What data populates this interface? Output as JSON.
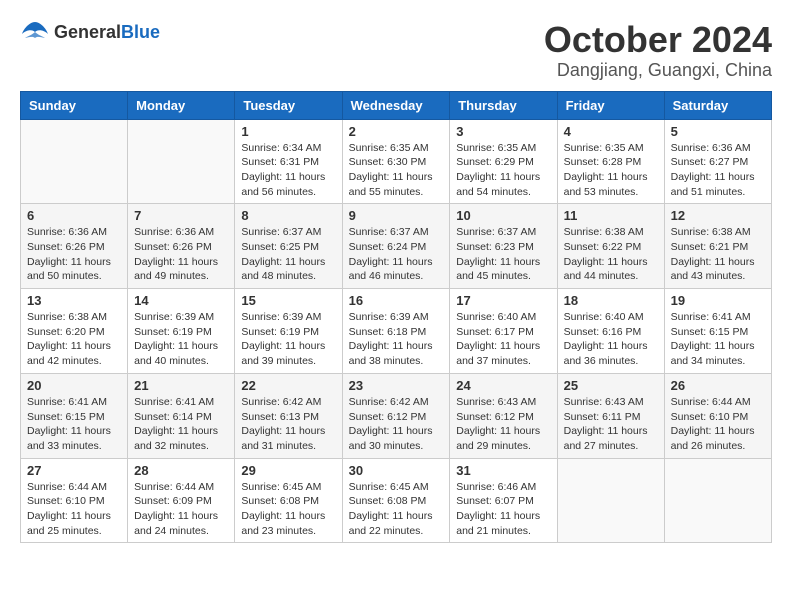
{
  "logo": {
    "general": "General",
    "blue": "Blue"
  },
  "title": "October 2024",
  "location": "Dangjiang, Guangxi, China",
  "days_of_week": [
    "Sunday",
    "Monday",
    "Tuesday",
    "Wednesday",
    "Thursday",
    "Friday",
    "Saturday"
  ],
  "weeks": [
    [
      {
        "day": "",
        "info": ""
      },
      {
        "day": "",
        "info": ""
      },
      {
        "day": "1",
        "sunrise": "Sunrise: 6:34 AM",
        "sunset": "Sunset: 6:31 PM",
        "daylight": "Daylight: 11 hours and 56 minutes."
      },
      {
        "day": "2",
        "sunrise": "Sunrise: 6:35 AM",
        "sunset": "Sunset: 6:30 PM",
        "daylight": "Daylight: 11 hours and 55 minutes."
      },
      {
        "day": "3",
        "sunrise": "Sunrise: 6:35 AM",
        "sunset": "Sunset: 6:29 PM",
        "daylight": "Daylight: 11 hours and 54 minutes."
      },
      {
        "day": "4",
        "sunrise": "Sunrise: 6:35 AM",
        "sunset": "Sunset: 6:28 PM",
        "daylight": "Daylight: 11 hours and 53 minutes."
      },
      {
        "day": "5",
        "sunrise": "Sunrise: 6:36 AM",
        "sunset": "Sunset: 6:27 PM",
        "daylight": "Daylight: 11 hours and 51 minutes."
      }
    ],
    [
      {
        "day": "6",
        "sunrise": "Sunrise: 6:36 AM",
        "sunset": "Sunset: 6:26 PM",
        "daylight": "Daylight: 11 hours and 50 minutes."
      },
      {
        "day": "7",
        "sunrise": "Sunrise: 6:36 AM",
        "sunset": "Sunset: 6:26 PM",
        "daylight": "Daylight: 11 hours and 49 minutes."
      },
      {
        "day": "8",
        "sunrise": "Sunrise: 6:37 AM",
        "sunset": "Sunset: 6:25 PM",
        "daylight": "Daylight: 11 hours and 48 minutes."
      },
      {
        "day": "9",
        "sunrise": "Sunrise: 6:37 AM",
        "sunset": "Sunset: 6:24 PM",
        "daylight": "Daylight: 11 hours and 46 minutes."
      },
      {
        "day": "10",
        "sunrise": "Sunrise: 6:37 AM",
        "sunset": "Sunset: 6:23 PM",
        "daylight": "Daylight: 11 hours and 45 minutes."
      },
      {
        "day": "11",
        "sunrise": "Sunrise: 6:38 AM",
        "sunset": "Sunset: 6:22 PM",
        "daylight": "Daylight: 11 hours and 44 minutes."
      },
      {
        "day": "12",
        "sunrise": "Sunrise: 6:38 AM",
        "sunset": "Sunset: 6:21 PM",
        "daylight": "Daylight: 11 hours and 43 minutes."
      }
    ],
    [
      {
        "day": "13",
        "sunrise": "Sunrise: 6:38 AM",
        "sunset": "Sunset: 6:20 PM",
        "daylight": "Daylight: 11 hours and 42 minutes."
      },
      {
        "day": "14",
        "sunrise": "Sunrise: 6:39 AM",
        "sunset": "Sunset: 6:19 PM",
        "daylight": "Daylight: 11 hours and 40 minutes."
      },
      {
        "day": "15",
        "sunrise": "Sunrise: 6:39 AM",
        "sunset": "Sunset: 6:19 PM",
        "daylight": "Daylight: 11 hours and 39 minutes."
      },
      {
        "day": "16",
        "sunrise": "Sunrise: 6:39 AM",
        "sunset": "Sunset: 6:18 PM",
        "daylight": "Daylight: 11 hours and 38 minutes."
      },
      {
        "day": "17",
        "sunrise": "Sunrise: 6:40 AM",
        "sunset": "Sunset: 6:17 PM",
        "daylight": "Daylight: 11 hours and 37 minutes."
      },
      {
        "day": "18",
        "sunrise": "Sunrise: 6:40 AM",
        "sunset": "Sunset: 6:16 PM",
        "daylight": "Daylight: 11 hours and 36 minutes."
      },
      {
        "day": "19",
        "sunrise": "Sunrise: 6:41 AM",
        "sunset": "Sunset: 6:15 PM",
        "daylight": "Daylight: 11 hours and 34 minutes."
      }
    ],
    [
      {
        "day": "20",
        "sunrise": "Sunrise: 6:41 AM",
        "sunset": "Sunset: 6:15 PM",
        "daylight": "Daylight: 11 hours and 33 minutes."
      },
      {
        "day": "21",
        "sunrise": "Sunrise: 6:41 AM",
        "sunset": "Sunset: 6:14 PM",
        "daylight": "Daylight: 11 hours and 32 minutes."
      },
      {
        "day": "22",
        "sunrise": "Sunrise: 6:42 AM",
        "sunset": "Sunset: 6:13 PM",
        "daylight": "Daylight: 11 hours and 31 minutes."
      },
      {
        "day": "23",
        "sunrise": "Sunrise: 6:42 AM",
        "sunset": "Sunset: 6:12 PM",
        "daylight": "Daylight: 11 hours and 30 minutes."
      },
      {
        "day": "24",
        "sunrise": "Sunrise: 6:43 AM",
        "sunset": "Sunset: 6:12 PM",
        "daylight": "Daylight: 11 hours and 29 minutes."
      },
      {
        "day": "25",
        "sunrise": "Sunrise: 6:43 AM",
        "sunset": "Sunset: 6:11 PM",
        "daylight": "Daylight: 11 hours and 27 minutes."
      },
      {
        "day": "26",
        "sunrise": "Sunrise: 6:44 AM",
        "sunset": "Sunset: 6:10 PM",
        "daylight": "Daylight: 11 hours and 26 minutes."
      }
    ],
    [
      {
        "day": "27",
        "sunrise": "Sunrise: 6:44 AM",
        "sunset": "Sunset: 6:10 PM",
        "daylight": "Daylight: 11 hours and 25 minutes."
      },
      {
        "day": "28",
        "sunrise": "Sunrise: 6:44 AM",
        "sunset": "Sunset: 6:09 PM",
        "daylight": "Daylight: 11 hours and 24 minutes."
      },
      {
        "day": "29",
        "sunrise": "Sunrise: 6:45 AM",
        "sunset": "Sunset: 6:08 PM",
        "daylight": "Daylight: 11 hours and 23 minutes."
      },
      {
        "day": "30",
        "sunrise": "Sunrise: 6:45 AM",
        "sunset": "Sunset: 6:08 PM",
        "daylight": "Daylight: 11 hours and 22 minutes."
      },
      {
        "day": "31",
        "sunrise": "Sunrise: 6:46 AM",
        "sunset": "Sunset: 6:07 PM",
        "daylight": "Daylight: 11 hours and 21 minutes."
      },
      {
        "day": "",
        "info": ""
      },
      {
        "day": "",
        "info": ""
      }
    ]
  ]
}
